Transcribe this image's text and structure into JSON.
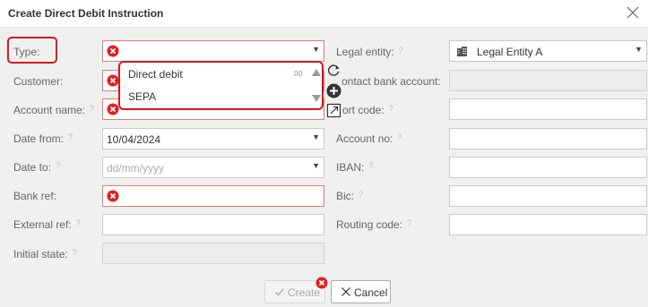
{
  "dialog": {
    "title": "Create Direct Debit Instruction"
  },
  "left_fields": {
    "type": {
      "label": "Type:",
      "value": ""
    },
    "customer": {
      "label": "Customer:",
      "value": ""
    },
    "account_name": {
      "label": "Account name:",
      "value": ""
    },
    "date_from": {
      "label": "Date from:",
      "value": "10/04/2024"
    },
    "date_to": {
      "label": "Date to:",
      "placeholder": "dd/mm/yyyy"
    },
    "bank_ref": {
      "label": "Bank ref:",
      "value": ""
    },
    "external_ref": {
      "label": "External ref:",
      "value": ""
    },
    "initial_state": {
      "label": "Initial state:",
      "value": ""
    }
  },
  "right_fields": {
    "legal_entity": {
      "label": "Legal entity:",
      "value": "Legal Entity A"
    },
    "contact_bank_account": {
      "label": "Contact bank account:",
      "label_visible": "ontact bank account:",
      "value": ""
    },
    "sort_code": {
      "label": "Sort code:",
      "label_visible": "ort code:",
      "value": ""
    },
    "account_no": {
      "label": "Account no:",
      "value": ""
    },
    "iban": {
      "label": "IBAN:",
      "value": ""
    },
    "bic": {
      "label": "Bic:",
      "value": ""
    },
    "routing_code": {
      "label": "Routing code:",
      "value": ""
    }
  },
  "type_dropdown": {
    "options": [
      {
        "label": "Direct debit",
        "code": "DD"
      },
      {
        "label": "SEPA"
      }
    ]
  },
  "help_glyph": "?",
  "buttons": {
    "create": "Create",
    "cancel": "Cancel"
  },
  "colors": {
    "highlight_red": "#d9161b",
    "error_red": "#e02020",
    "dialog_bg": "#f0f0f0"
  }
}
